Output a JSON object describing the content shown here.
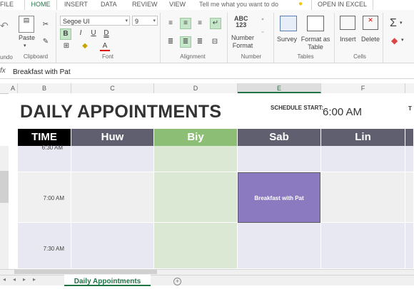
{
  "ribbon_tabs": [
    "FILE",
    "HOME",
    "INSERT",
    "DATA",
    "REVIEW",
    "VIEW"
  ],
  "tell_me_placeholder": "Tell me what you want to do",
  "open_in_excel": "OPEN IN EXCEL",
  "clipboard": {
    "paste": "Paste",
    "label": "Clipboard",
    "undo_label": "undo"
  },
  "font": {
    "name": "Segoe UI",
    "size": "9",
    "bold": "B",
    "italic": "I",
    "underline": "U",
    "doubleunderline": "D",
    "label": "Font"
  },
  "alignment": {
    "label": "Alignment"
  },
  "number": {
    "icon_text": "ABC\n123",
    "format_label": "Number Format",
    "label": "Number"
  },
  "tables": {
    "survey": "Survey",
    "format_as_table": "Format as Table",
    "label": "Tables"
  },
  "cells": {
    "insert": "Insert",
    "delete": "Delete",
    "label": "Cells"
  },
  "formula_bar": {
    "fx": "fx",
    "content": "Breakfast with Pat"
  },
  "columns": [
    "A",
    "B",
    "C",
    "D",
    "E",
    "F"
  ],
  "sheet": {
    "title": "DAILY APPOINTMENTS",
    "schedule_label": "SCHEDULE START:",
    "schedule_value": "6:00 AM",
    "cut_label": "T",
    "headers": [
      "TIME",
      "Huw",
      "Biy",
      "Sab",
      "Lin"
    ],
    "header_colors": [
      "#000000",
      "#5f5f70",
      "#8cbf75",
      "#5f5f70",
      "#5f5f70"
    ],
    "times": [
      "6:30 AM",
      "7:00 AM",
      "7:30 AM"
    ],
    "appointment": "Breakfast with Pat"
  },
  "sheet_tab": "Daily Appointments",
  "add_sheet": "+",
  "colors": {
    "accent": "#217346",
    "appointment": "#8b7ac0",
    "row_band": "#e8e8f2",
    "biy_column": "#dbe9d4"
  }
}
